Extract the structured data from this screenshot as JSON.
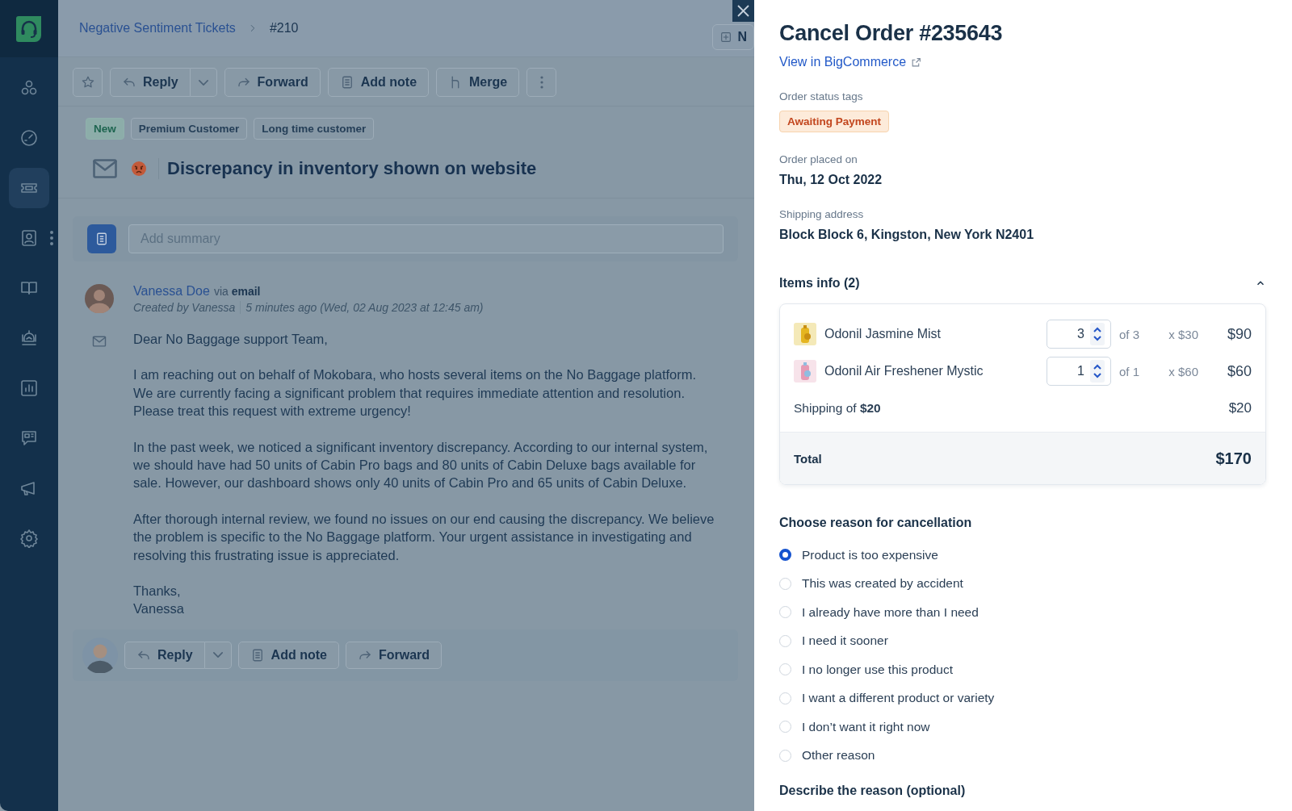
{
  "sidebar": {
    "items": [
      {
        "selected": false
      },
      {
        "selected": false
      },
      {
        "selected": true
      },
      {
        "selected": false
      },
      {
        "selected": false
      },
      {
        "selected": false
      },
      {
        "selected": false
      },
      {
        "selected": false
      },
      {
        "selected": false
      },
      {
        "selected": false
      }
    ]
  },
  "breadcrumb": {
    "parent": "Negative Sentiment Tickets",
    "current": "#210"
  },
  "header_button": {
    "label": "N"
  },
  "toolbar": {
    "buttons": [
      {
        "kind": "icon"
      },
      {
        "kind": "split",
        "label": "Reply"
      },
      {
        "kind": "plain",
        "label": "Forward"
      },
      {
        "kind": "plain",
        "label": "Add note"
      },
      {
        "kind": "plain",
        "label": "Merge"
      },
      {
        "kind": "icon"
      }
    ]
  },
  "tags": [
    {
      "label": "New",
      "kind": "status"
    },
    {
      "label": "Premium Customer",
      "kind": "plain"
    },
    {
      "label": "Long time customer",
      "kind": "plain"
    }
  ],
  "ticket": {
    "title": "Discrepancy in inventory shown on website"
  },
  "summary": {
    "placeholder": "Add summary"
  },
  "message": {
    "author": "Vanessa Doe",
    "via": "via **email**",
    "created_by": "Created by Vanessa",
    "time": "5 minutes ago (Wed, 02 Aug 2023 at 12:45 am)",
    "paragraphs": [
      [
        "Dear No Baggage support Team,"
      ],
      [
        "I am reaching out on behalf of Mokobara, who hosts several items on the No Baggage platform. We are currently facing a significant problem that requires immediate attention and resolution. Please treat this request with extreme urgency!"
      ],
      [
        "In the past week, we noticed a significant inventory discrepancy. According to our internal system, we should have had 50 units of Cabin Pro bags and 80 units of Cabin Deluxe bags available for sale. However, our dashboard shows only 40 units of Cabin Pro and 65 units of Cabin Deluxe."
      ],
      [
        "After thorough internal review, we found no issues on our end causing the discrepancy. We believe the problem is specific to the No Baggage platform. Your urgent assistance in investigating and resolving this frustrating issue is appreciated."
      ],
      [
        "Thanks,",
        "Vanessa"
      ]
    ]
  },
  "reply_bar": {
    "buttons": [
      {
        "kind": "split",
        "label": "Reply"
      },
      {
        "kind": "plain",
        "label": "Add note"
      },
      {
        "kind": "plain",
        "label": "Forward"
      }
    ]
  },
  "order": {
    "title": "Cancel Order #235643",
    "link": "View in BigCommerce",
    "status_label": "Order status tags",
    "status_tags": [
      {
        "label": "Awaiting Payment"
      }
    ],
    "placed_label": "Order placed on",
    "placed": "Thu, 12 Oct 2022",
    "address_label": "Shipping address",
    "address": "Block Block 6, Kingston, New York N2401",
    "items_title": "Items info (2)",
    "items_expanded": true,
    "items": [
      {
        "name": "Odonil Jasmine Mist",
        "quantity": "3",
        "available": "of 3",
        "unit_price": "x $30",
        "amount": "$90"
      },
      {
        "name": "Odonil Air Freshener Mystic",
        "quantity": "1",
        "available": "of 1",
        "unit_price": "x $60",
        "amount": "$60"
      }
    ],
    "shipping_label": "Shipping of  **$20**",
    "shipping_amount": "$20",
    "total_label": "Total",
    "total": "$170",
    "reason_title": "Choose reason for cancellation",
    "reasons": [
      {
        "label": "Product is too expensive",
        "selected": true
      },
      {
        "label": "This was created by accident",
        "selected": false
      },
      {
        "label": "I already have more than I need",
        "selected": false
      },
      {
        "label": "I need it sooner",
        "selected": false
      },
      {
        "label": "I no longer use this product",
        "selected": false
      },
      {
        "label": "I want a different product or variety",
        "selected": false
      },
      {
        "label": "I don’t want it right now",
        "selected": false
      },
      {
        "label": "Other reason",
        "selected": false
      }
    ],
    "describe_label": "Describe the reason (optional)"
  }
}
